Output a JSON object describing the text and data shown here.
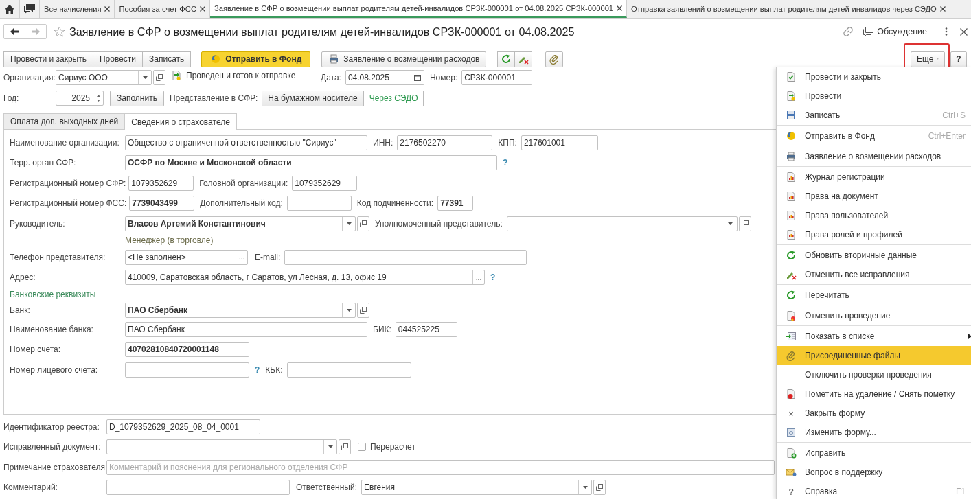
{
  "tab_bar": {
    "tabs": [
      {
        "label": "Все начисления",
        "selected": false
      },
      {
        "label": "Пособия за счет ФСС",
        "selected": false
      },
      {
        "label": "Заявление в СФР о возмещении выплат родителям детей-инвалидов СРЗК-000001 от 04.08.2025 СРЗК-000001",
        "selected": true
      },
      {
        "label": "Отправка заявлений о возмещении выплат родителям детей-инвалидов через СЭДО",
        "selected": false
      }
    ]
  },
  "title": "Заявление в СФР о возмещении выплат родителям детей-инвалидов СРЗК-000001 от 04.08.2025",
  "discussion": "Обсуждение",
  "toolbar": {
    "post_group": [
      "Провести и закрыть",
      "Провести",
      "Записать"
    ],
    "send": "Отправить в Фонд",
    "print": "Заявление о возмещении расходов",
    "more": {
      "label": "Еще",
      "highlighted": true
    },
    "help": "?"
  },
  "head": {
    "organization": {
      "label": "Организация:",
      "value": "Сириус ООО"
    },
    "status": "Проведен и готов к отправке",
    "date": {
      "label": "Дата:",
      "value": "04.08.2025"
    },
    "number": {
      "label": "Номер:",
      "value": "СРЗК-000001"
    },
    "year": {
      "label": "Год:",
      "value": "2025"
    },
    "fill": "Заполнить",
    "representation": {
      "label": "Представление в СФР:",
      "options": [
        {
          "label": "На бумажном носителе",
          "selected": false
        },
        {
          "label": "Через СЭДО",
          "selected": true
        }
      ]
    }
  },
  "form_tabs": [
    {
      "label": "Оплата доп. выходных дней",
      "selected": false
    },
    {
      "label": "Сведения о страхователе",
      "selected": true
    }
  ],
  "insurer": {
    "org_name": {
      "label": "Наименование организации:",
      "value": "Общество с ограниченной ответственностью \"Сириус\""
    },
    "inn": {
      "label": "ИНН:",
      "value": "2176502270"
    },
    "kpp": {
      "label": "КПП:",
      "value": "217601001"
    },
    "terr_body": {
      "label": "Терр. орган СФР:",
      "value": "ОСФР по Москве и Московской области",
      "hint": "?"
    },
    "reg_sfr": {
      "label": "Регистрационный номер СФР:",
      "value": "1079352629"
    },
    "head_org": {
      "label": "Головной организации:",
      "value": "1079352629"
    },
    "reg_fss": {
      "label": "Регистрационный номер ФСС:",
      "value": "7739043499"
    },
    "extra_code": {
      "label": "Дополнительный код:"
    },
    "sub_code": {
      "label": "Код подчиненности:",
      "value": "77391"
    },
    "director": {
      "label": "Руководитель:",
      "value": "Власов Артемий Константинович",
      "position": "Менеджер (в торговле)"
    },
    "representative": {
      "label": "Уполномоченный представитель:"
    },
    "phone": {
      "label": "Телефон представителя:",
      "value": "<Не заполнен>",
      "pick": "..."
    },
    "email": {
      "label": "E-mail:"
    },
    "address": {
      "label": "Адрес:",
      "value": "410009, Саратовская область, г Саратов, ул Лесная, д. 13, офис 19",
      "pick": "...",
      "hint": "?"
    },
    "bank_section": "Банковские реквизиты",
    "bank": {
      "label": "Банк:",
      "value": "ПАО Сбербанк"
    },
    "bank_name": {
      "label": "Наименование банка:",
      "value": "ПАО Сбербанк"
    },
    "bik": {
      "label": "БИК:",
      "value": "044525225"
    },
    "account": {
      "label": "Номер счета:",
      "value": "40702810840720001148"
    },
    "personal_account": {
      "label": "Номер лицевого счета:",
      "hint": "?"
    },
    "kbk": {
      "label": "КБК:"
    }
  },
  "footer": {
    "registry_id": {
      "label": "Идентификатор реестра:",
      "value": "D_1079352629_2025_08_04_0001"
    },
    "corrected_doc": {
      "label": "Исправленный документ:"
    },
    "recalc": {
      "label": "Перерасчет",
      "checked": false
    },
    "note": {
      "label": "Примечание страхователя:",
      "placeholder": "Комментарий и пояснения для регионального отделения СФР"
    },
    "comment": {
      "label": "Комментарий:"
    },
    "responsible": {
      "label": "Ответственный:",
      "value": "Евгения"
    }
  },
  "more_menu": {
    "groups": [
      [
        {
          "label": "Провести и закрыть",
          "highlighted": false,
          "submenu": false
        },
        {
          "label": "Провести",
          "highlighted": false,
          "submenu": false
        },
        {
          "label": "Записать",
          "shortcut": "Ctrl+S",
          "highlighted": false,
          "submenu": false
        }
      ],
      [
        {
          "label": "Отправить в Фонд",
          "shortcut": "Ctrl+Enter",
          "highlighted": false,
          "submenu": false
        }
      ],
      [
        {
          "label": "Заявление о возмещении расходов",
          "highlighted": false,
          "submenu": false
        }
      ],
      [
        {
          "label": "Журнал регистрации",
          "highlighted": false,
          "submenu": false
        },
        {
          "label": "Права на документ",
          "highlighted": false,
          "submenu": false
        },
        {
          "label": "Права пользователей",
          "highlighted": false,
          "submenu": false
        },
        {
          "label": "Права ролей и профилей",
          "highlighted": false,
          "submenu": false
        }
      ],
      [
        {
          "label": "Обновить вторичные данные",
          "highlighted": false,
          "submenu": false
        },
        {
          "label": "Отменить все исправления",
          "highlighted": false,
          "submenu": false
        }
      ],
      [
        {
          "label": "Перечитать",
          "highlighted": false,
          "submenu": false
        }
      ],
      [
        {
          "label": "Отменить проведение",
          "highlighted": false,
          "submenu": false
        }
      ],
      [
        {
          "label": "Показать в списке",
          "highlighted": false,
          "submenu": true
        },
        {
          "label": "Присоединенные файлы",
          "highlighted": true,
          "submenu": false
        },
        {
          "label": "Отключить проверки проведения",
          "highlighted": false,
          "submenu": false
        },
        {
          "label": "Пометить на удаление / Снять пометку",
          "highlighted": false,
          "submenu": false
        },
        {
          "label": "Закрыть форму",
          "glyph": "×",
          "highlighted": false,
          "submenu": false
        },
        {
          "label": "Изменить форму...",
          "highlighted": false,
          "submenu": false
        }
      ],
      [
        {
          "label": "Исправить",
          "highlighted": false,
          "submenu": false
        },
        {
          "label": "Вопрос в поддержку",
          "highlighted": false,
          "submenu": false
        },
        {
          "label": "Справка",
          "glyph": "?",
          "shortcut": "F1",
          "highlighted": false,
          "submenu": false
        }
      ]
    ]
  }
}
